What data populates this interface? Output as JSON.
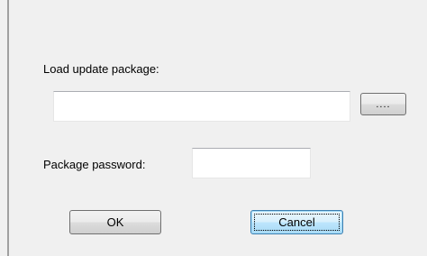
{
  "dialog": {
    "load_label": "Load update package:",
    "package_path": {
      "value": "",
      "placeholder": ""
    },
    "browse_label": "....",
    "password_label": "Package password:",
    "password": {
      "value": "",
      "placeholder": ""
    },
    "ok_label": "OK",
    "cancel_label": "Cancel"
  }
}
